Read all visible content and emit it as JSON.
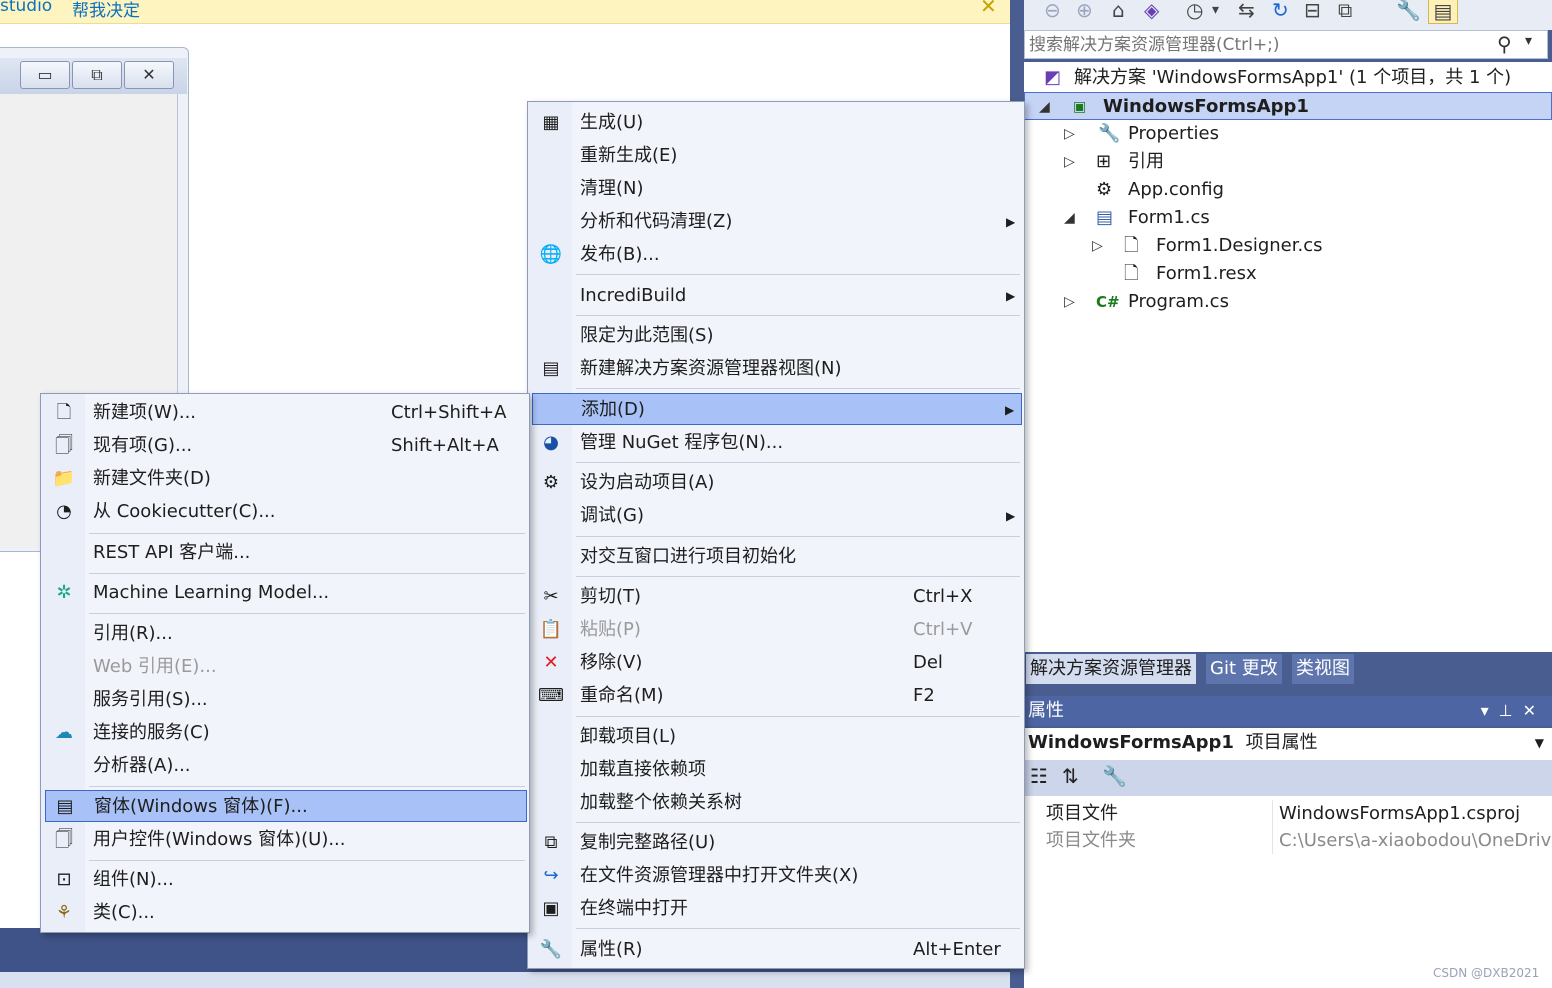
{
  "app_title": {
    "partial_left": "studio",
    "help_label": "帮我决定",
    "close_glyph": "✕"
  },
  "designer": {
    "buttons": [
      "▭",
      "⧉",
      "✕"
    ]
  },
  "solution_explorer": {
    "search_placeholder": "搜索解决方案资源管理器(Ctrl+;)",
    "tree": {
      "solution": "解决方案 'WindowsFormsApp1' (1 个项目，共 1 个)",
      "project": "WindowsFormsApp1",
      "properties": "Properties",
      "references": "引用",
      "app_config": "App.config",
      "form1": "Form1.cs",
      "form1_designer": "Form1.Designer.cs",
      "form1_resx": "Form1.resx",
      "program": "Program.cs"
    },
    "tabs": [
      "解决方案资源管理器",
      "Git 更改",
      "类视图"
    ]
  },
  "properties_panel": {
    "title": "属性",
    "object_name": "WindowsFormsApp1",
    "object_type": "项目属性",
    "rows": [
      {
        "key": "项目文件",
        "value": "WindowsFormsApp1.csproj"
      },
      {
        "key": "项目文件夹",
        "value": "C:\\Users\\a-xiaobodou\\OneDrive"
      }
    ]
  },
  "context_menu": {
    "build": "生成(U)",
    "rebuild": "重新生成(E)",
    "clean": "清理(N)",
    "analyze": "分析和代码清理(Z)",
    "publish": "发布(B)...",
    "incredibuild": "IncrediBuild",
    "scope": "限定为此范围(S)",
    "new_view": "新建解决方案资源管理器视图(N)",
    "add": "添加(D)",
    "nuget": "管理 NuGet 程序包(N)...",
    "startup": "设为启动项目(A)",
    "debug": "调试(G)",
    "interactive": "对交互窗口进行项目初始化",
    "cut": "剪切(T)",
    "cut_sc": "Ctrl+X",
    "paste": "粘贴(P)",
    "paste_sc": "Ctrl+V",
    "remove": "移除(V)",
    "remove_sc": "Del",
    "rename": "重命名(M)",
    "rename_sc": "F2",
    "unload": "卸载项目(L)",
    "load_direct": "加载直接依赖项",
    "load_tree": "加载整个依赖关系树",
    "copy_path": "复制完整路径(U)",
    "open_folder": "在文件资源管理器中打开文件夹(X)",
    "open_terminal": "在终端中打开",
    "properties": "属性(R)",
    "properties_sc": "Alt+Enter"
  },
  "add_submenu": {
    "new_item": "新建项(W)...",
    "new_item_sc": "Ctrl+Shift+A",
    "existing_item": "现有项(G)...",
    "existing_item_sc": "Shift+Alt+A",
    "new_folder": "新建文件夹(D)",
    "cookiecutter": "从 Cookiecutter(C)...",
    "rest_api": "REST API 客户端...",
    "ml_model": "Machine Learning Model...",
    "reference": "引用(R)...",
    "web_reference": "Web 引用(E)...",
    "service_reference": "服务引用(S)...",
    "connected_service": "连接的服务(C)",
    "analyzer": "分析器(A)...",
    "windows_form": "窗体(Windows 窗体)(F)...",
    "user_control": "用户控件(Windows 窗体)(U)...",
    "component": "组件(N)...",
    "class": "类(C)..."
  },
  "watermark": "CSDN @DXB2021",
  "colors": {
    "highlight": "#a8c2f7",
    "highlight_border": "#3f66c9",
    "panel_blue": "#4a5d90",
    "info_bar": "#fdf4bf"
  }
}
